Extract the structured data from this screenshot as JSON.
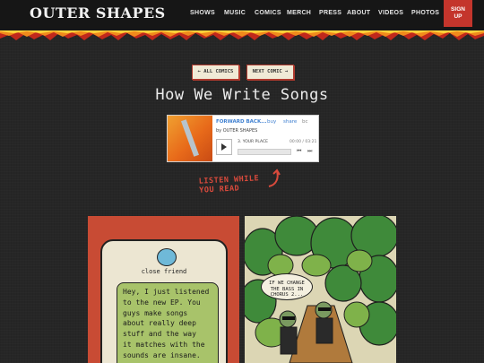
{
  "header": {
    "logo": "OUTER SHAPES",
    "nav": [
      "SHOWS",
      "MUSIC",
      "COMICS",
      "MERCH",
      "PRESS",
      "ABOUT",
      "VIDEOS",
      "PHOTOS"
    ],
    "signup": "SIGN UP"
  },
  "buttons": {
    "all_comics": "← ALL COMICS",
    "next_comic": "NEXT COMIC →"
  },
  "page_title": "How We Write Songs",
  "player": {
    "title": "FORWARD BACK...",
    "buy": "buy",
    "share": "share",
    "bc": "bc",
    "by": "by OUTER SHAPES",
    "track": "3. YOUR PLACE",
    "time": "00:00 / 03:21",
    "progress": 0
  },
  "listen_note": "LISTEN WHILE\nYOU READ",
  "comic": {
    "contact_name": "close friend",
    "message": "Hey, I just listened\nto the new EP. You\nguys make songs\nabout really deep\nstuff and the way\nit matches with the\nsounds are insane.\nWhat does your",
    "speech": "IF WE CHANGE\nTHE BASS IN\nCHORUS 2..."
  },
  "colors": {
    "signup": "#c4352c",
    "accent_red": "#d94a3c",
    "link_blue": "#3d7fd0"
  }
}
